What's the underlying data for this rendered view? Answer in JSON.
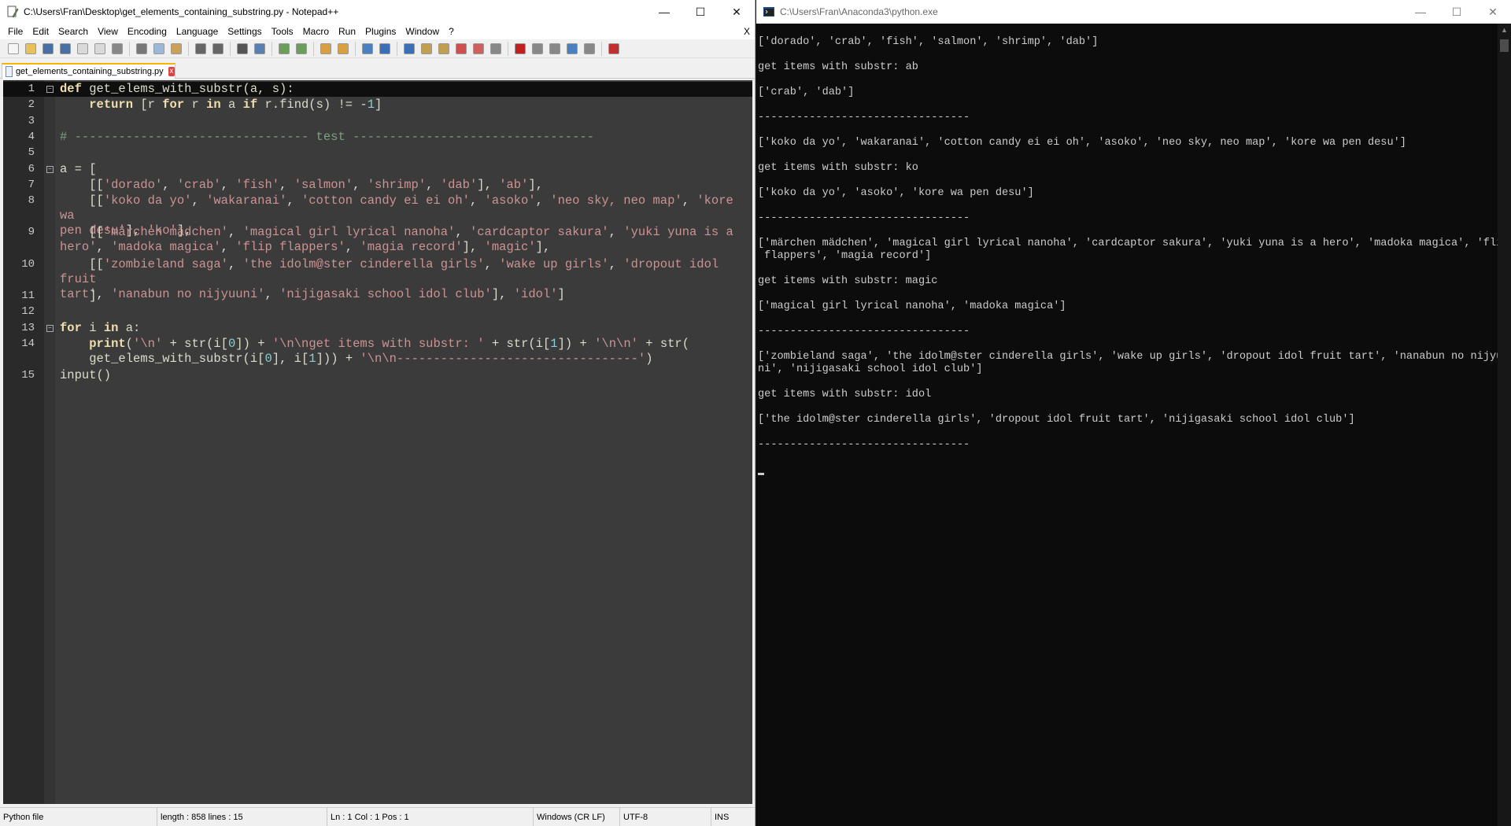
{
  "npp": {
    "title": "C:\\Users\\Fran\\Desktop\\get_elements_containing_substring.py - Notepad++",
    "menu": [
      "File",
      "Edit",
      "Search",
      "View",
      "Encoding",
      "Language",
      "Settings",
      "Tools",
      "Macro",
      "Run",
      "Plugins",
      "Window",
      "?"
    ],
    "menu_close": "X",
    "tab_label": "get_elements_containing_substring.py",
    "tab_close": "x",
    "lines": [
      {
        "n": "1",
        "fold": "−",
        "html": "<span class='kw'>def</span> get_elems_with_substr(a, s):"
      },
      {
        "n": "2",
        "fold": "",
        "html": "    <span class='kw'>return</span> [r <span class='kw'>for</span> r <span class='kw'>in</span> a <span class='kw'>if</span> r.find(s) != -<span class='nm'>1</span>]"
      },
      {
        "n": "3",
        "fold": "",
        "html": ""
      },
      {
        "n": "4",
        "fold": "",
        "html": "<span class='cm'># -------------------------------- test ---------------------------------</span>"
      },
      {
        "n": "5",
        "fold": "",
        "html": ""
      },
      {
        "n": "6",
        "fold": "−",
        "html": "a = ["
      },
      {
        "n": "7",
        "fold": "",
        "html": "    [[<span class='st'>'dorado'</span>, <span class='st'>'crab'</span>, <span class='st'>'fish'</span>, <span class='st'>'salmon'</span>, <span class='st'>'shrimp'</span>, <span class='st'>'dab'</span>], <span class='st'>'ab'</span>],"
      },
      {
        "n": "8",
        "fold": "",
        "html": "    [[<span class='st'>'koko da yo'</span>, <span class='st'>'wakaranai'</span>, <span class='st'>'cotton candy ei ei oh'</span>, <span class='st'>'asoko'</span>, <span class='st'>'neo sky, neo map'</span>, <span class='st'>'kore wa\npen desu'</span>], <span class='st'>'ko'</span>],"
      },
      {
        "n": "9",
        "fold": "",
        "html": "    [[<span class='st'>'märchen mädchen'</span>, <span class='st'>'magical girl lyrical nanoha'</span>, <span class='st'>'cardcaptor sakura'</span>, <span class='st'>'yuki yuna is a\nhero'</span>, <span class='st'>'madoka magica'</span>, <span class='st'>'flip flappers'</span>, <span class='st'>'magia record'</span>], <span class='st'>'magic'</span>],"
      },
      {
        "n": "10",
        "fold": "",
        "html": "    [[<span class='st'>'zombieland saga'</span>, <span class='st'>'the idolm@ster cinderella girls'</span>, <span class='st'>'wake up girls'</span>, <span class='st'>'dropout idol fruit\ntart'</span>, <span class='st'>'nanabun no nijyuuni'</span>, <span class='st'>'nijigasaki school idol club'</span>], <span class='st'>'idol'</span>]"
      },
      {
        "n": "11",
        "fold": "",
        "html": "    ]"
      },
      {
        "n": "12",
        "fold": "",
        "html": ""
      },
      {
        "n": "13",
        "fold": "−",
        "html": "<span class='kw'>for</span> i <span class='kw'>in</span> a:"
      },
      {
        "n": "14",
        "fold": "",
        "html": "    <span class='kw'>print</span>(<span class='st'>'\\n'</span> + str(i[<span class='nm'>0</span>]) + <span class='st'>'\\n\\nget items with substr: '</span> + str(i[<span class='nm'>1</span>]) + <span class='st'>'\\n\\n'</span> + str(\n    get_elems_with_substr(i[<span class='nm'>0</span>], i[<span class='nm'>1</span>])) + <span class='st'>'\\n\\n---------------------------------'</span>)"
      },
      {
        "n": "15",
        "fold": "",
        "html": "input()"
      }
    ],
    "status": {
      "type": "Python file",
      "length": "length : 858    lines : 15",
      "pos": "Ln : 1    Col : 1    Pos : 1",
      "eol": "Windows (CR LF)",
      "enc": "UTF-8",
      "mode": "INS"
    }
  },
  "console": {
    "title": "C:\\Users\\Fran\\Anaconda3\\python.exe",
    "lines": [
      "['dorado', 'crab', 'fish', 'salmon', 'shrimp', 'dab']",
      "",
      "get items with substr: ab",
      "",
      "['crab', 'dab']",
      "",
      "---------------------------------",
      "",
      "['koko da yo', 'wakaranai', 'cotton candy ei ei oh', 'asoko', 'neo sky, neo map', 'kore wa pen desu']",
      "",
      "get items with substr: ko",
      "",
      "['koko da yo', 'asoko', 'kore wa pen desu']",
      "",
      "---------------------------------",
      "",
      "['märchen mädchen', 'magical girl lyrical nanoha', 'cardcaptor sakura', 'yuki yuna is a hero', 'madoka magica', 'flip",
      " flappers', 'magia record']",
      "",
      "get items with substr: magic",
      "",
      "['magical girl lyrical nanoha', 'madoka magica']",
      "",
      "---------------------------------",
      "",
      "['zombieland saga', 'the idolm@ster cinderella girls', 'wake up girls', 'dropout idol fruit tart', 'nanabun no nijyuu",
      "ni', 'nijigasaki school idol club']",
      "",
      "get items with substr: idol",
      "",
      "['the idolm@ster cinderella girls', 'dropout idol fruit tart', 'nijigasaki school idol club']",
      "",
      "---------------------------------",
      ""
    ]
  }
}
